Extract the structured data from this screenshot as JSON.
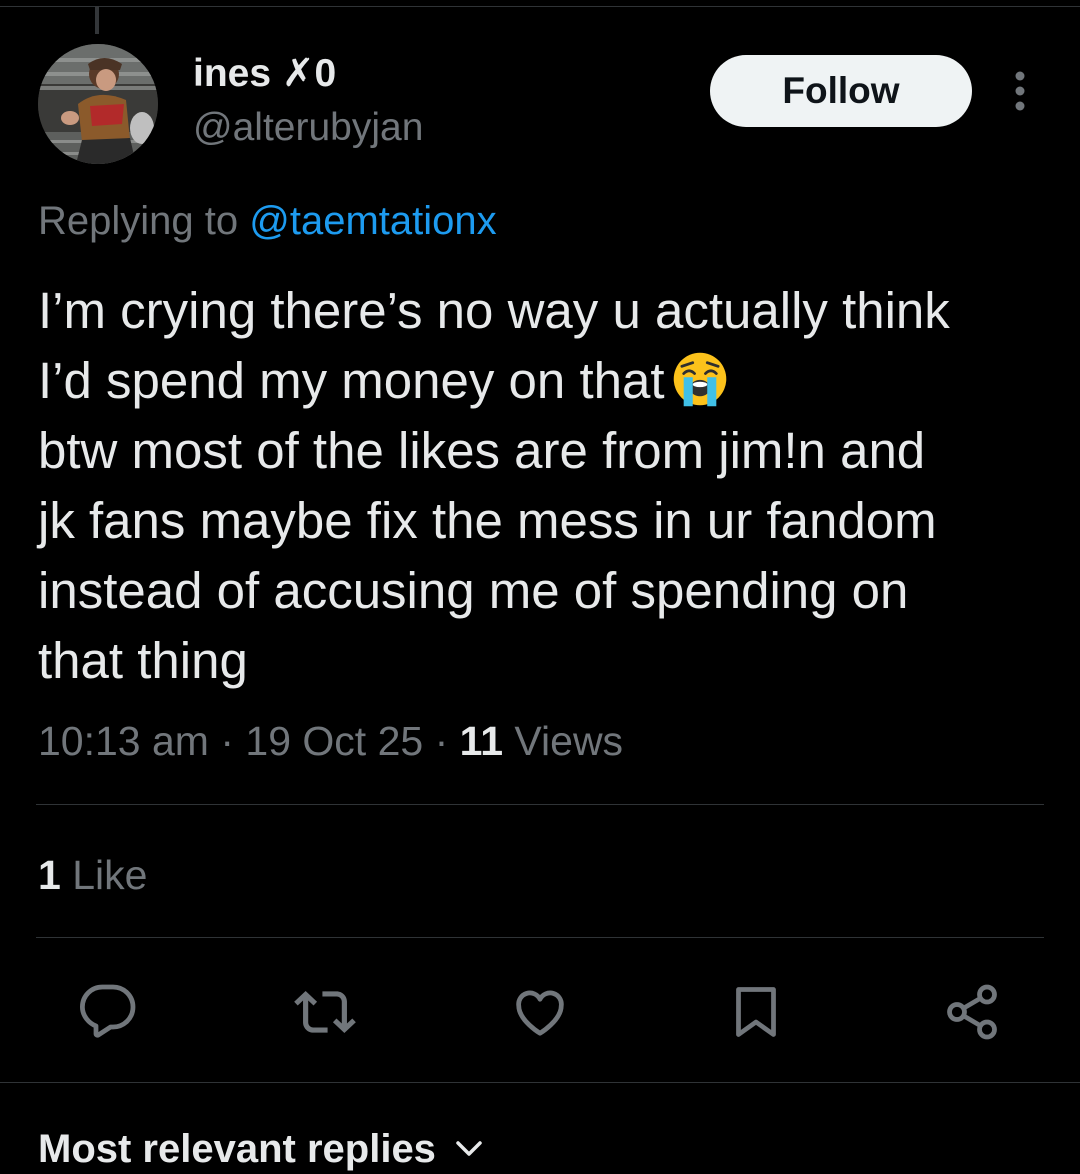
{
  "tweet": {
    "author": {
      "display_name": "ines ✗0",
      "handle": "@alterubyjan"
    },
    "follow_label": "Follow",
    "replying_prefix": "Replying to",
    "replying_to": "@taemtationx",
    "text_lines": [
      "I’m crying there’s no way u actually think",
      "I’d spend my money on that",
      "btw most of the likes are from jim!n and",
      "jk fans maybe fix the mess in ur fandom",
      "instead of accusing me of spending on",
      "that thing"
    ],
    "emoji": "loudly-crying-face-emoji",
    "time": "10:13 am",
    "separator": "·",
    "date": "19 Oct 25",
    "views_count": "11",
    "views_label": "Views",
    "likes_count": "1",
    "likes_label": "Like"
  },
  "actions": [
    {
      "name": "reply",
      "icon": "reply-icon"
    },
    {
      "name": "retweet",
      "icon": "retweet-icon"
    },
    {
      "name": "like",
      "icon": "heart-icon"
    },
    {
      "name": "bookmark",
      "icon": "bookmark-icon"
    },
    {
      "name": "share",
      "icon": "share-icon"
    }
  ],
  "replies_sort": {
    "label": "Most relevant replies"
  },
  "colors": {
    "background": "#000000",
    "text": "#e7e9ea",
    "muted": "#71767b",
    "link": "#1d9bf0",
    "divider": "#2f3336",
    "button_bg": "#eff3f4",
    "button_text": "#0f1419"
  }
}
